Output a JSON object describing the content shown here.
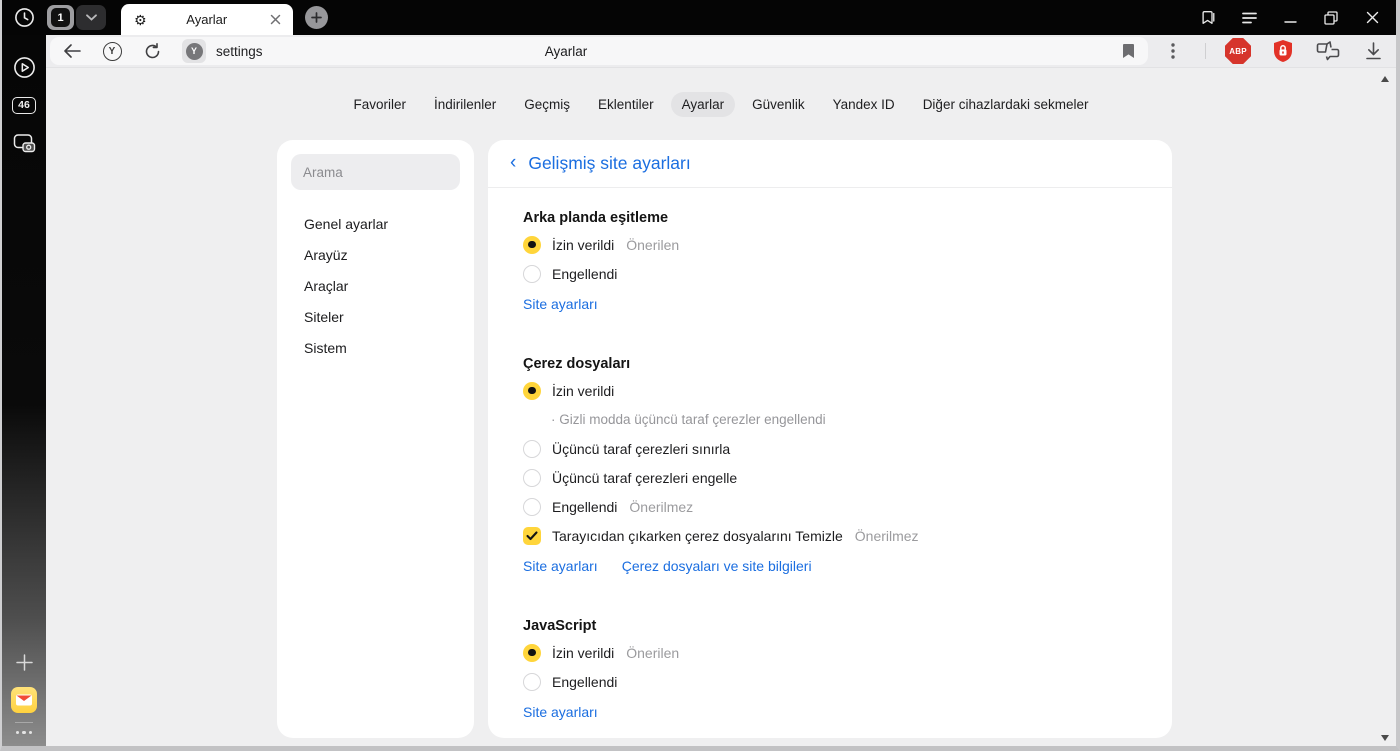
{
  "colors": {
    "accent_yellow": "#ffd53b",
    "link_blue": "#1b6ee0",
    "abp_red": "#d6352c",
    "protect_red": "#e23227",
    "tabbar_black": "#050505",
    "page_bg": "#efeff0",
    "panel_white": "#ffffff"
  },
  "icons": {
    "gear": "⚙",
    "yandex_letter": "Y",
    "back_chevron": "‹"
  },
  "tabbar": {
    "tab_group_count": "1",
    "active_tab_title": "Ayarlar"
  },
  "toolbar": {
    "omnibox_text": "settings",
    "page_title": "Ayarlar",
    "abp_label": "ABP"
  },
  "sidebar": {
    "tabs_badge": "46"
  },
  "nav_tabs": {
    "active": "Ayarlar",
    "items": [
      {
        "label": "Favoriler"
      },
      {
        "label": "İndirilenler"
      },
      {
        "label": "Geçmiş"
      },
      {
        "label": "Eklentiler"
      },
      {
        "label": "Ayarlar"
      },
      {
        "label": "Güvenlik"
      },
      {
        "label": "Yandex ID"
      },
      {
        "label": "Diğer cihazlardaki sekmeler"
      }
    ]
  },
  "settings_nav": {
    "search_placeholder": "Arama",
    "items": [
      {
        "label": "Genel ayarlar"
      },
      {
        "label": "Arayüz"
      },
      {
        "label": "Araçlar"
      },
      {
        "label": "Siteler"
      },
      {
        "label": "Sistem"
      }
    ]
  },
  "content": {
    "back_header": "Gelişmiş site ayarları",
    "sections": [
      {
        "title": "Arka planda eşitleme",
        "options": [
          {
            "type": "radio",
            "checked": true,
            "label": "İzin verildi",
            "note": "Önerilen"
          },
          {
            "type": "radio",
            "checked": false,
            "label": "Engellendi"
          }
        ],
        "links": [
          "Site ayarları"
        ]
      },
      {
        "title": "Çerez dosyaları",
        "options": [
          {
            "type": "radio",
            "checked": true,
            "label": "İzin verildi",
            "sub": "· Gizli modda üçüncü taraf çerezler engellendi"
          },
          {
            "type": "radio",
            "checked": false,
            "label": "Üçüncü taraf çerezleri sınırla"
          },
          {
            "type": "radio",
            "checked": false,
            "label": "Üçüncü taraf çerezleri engelle"
          },
          {
            "type": "radio",
            "checked": false,
            "label": "Engellendi",
            "note": "Önerilmez"
          },
          {
            "type": "checkbox",
            "checked": true,
            "label": "Tarayıcıdan çıkarken çerez dosyalarını Temizle",
            "note": "Önerilmez"
          }
        ],
        "links": [
          "Site ayarları",
          "Çerez dosyaları ve site bilgileri"
        ]
      },
      {
        "title": "JavaScript",
        "options": [
          {
            "type": "radio",
            "checked": true,
            "label": "İzin verildi",
            "note": "Önerilen"
          },
          {
            "type": "radio",
            "checked": false,
            "label": "Engellendi"
          }
        ],
        "links": [
          "Site ayarları"
        ]
      }
    ]
  }
}
